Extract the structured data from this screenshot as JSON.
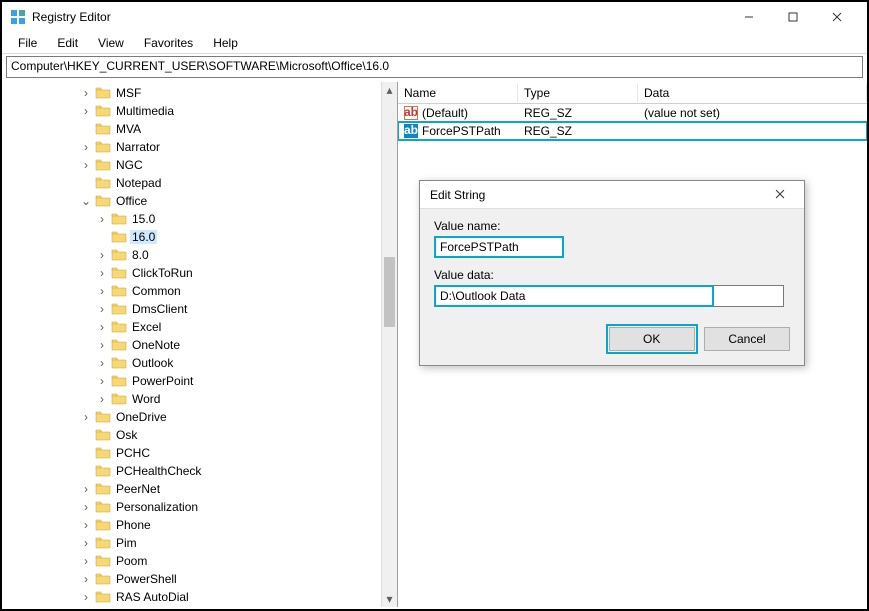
{
  "window": {
    "title": "Registry Editor"
  },
  "menu": {
    "file": "File",
    "edit": "Edit",
    "view": "View",
    "favorites": "Favorites",
    "help": "Help"
  },
  "address": "Computer\\HKEY_CURRENT_USER\\SOFTWARE\\Microsoft\\Office\\16.0",
  "columns": {
    "name": "Name",
    "type": "Type",
    "data": "Data"
  },
  "values": [
    {
      "name": "(Default)",
      "type": "REG_SZ",
      "data": "(value not set)",
      "selected": false
    },
    {
      "name": "ForcePSTPath",
      "type": "REG_SZ",
      "data": "",
      "selected": true
    }
  ],
  "tree": {
    "items": [
      {
        "label": "MSF",
        "depth": 3,
        "expander": ">"
      },
      {
        "label": "Multimedia",
        "depth": 3,
        "expander": ">"
      },
      {
        "label": "MVA",
        "depth": 3,
        "expander": ""
      },
      {
        "label": "Narrator",
        "depth": 3,
        "expander": ">"
      },
      {
        "label": "NGC",
        "depth": 3,
        "expander": ">"
      },
      {
        "label": "Notepad",
        "depth": 3,
        "expander": ""
      },
      {
        "label": "Office",
        "depth": 3,
        "expander": "v"
      },
      {
        "label": "15.0",
        "depth": 4,
        "expander": ">"
      },
      {
        "label": "16.0",
        "depth": 4,
        "expander": "",
        "selected": true
      },
      {
        "label": "8.0",
        "depth": 4,
        "expander": ">"
      },
      {
        "label": "ClickToRun",
        "depth": 4,
        "expander": ">"
      },
      {
        "label": "Common",
        "depth": 4,
        "expander": ">"
      },
      {
        "label": "DmsClient",
        "depth": 4,
        "expander": ">"
      },
      {
        "label": "Excel",
        "depth": 4,
        "expander": ">"
      },
      {
        "label": "OneNote",
        "depth": 4,
        "expander": ">"
      },
      {
        "label": "Outlook",
        "depth": 4,
        "expander": ">"
      },
      {
        "label": "PowerPoint",
        "depth": 4,
        "expander": ">"
      },
      {
        "label": "Word",
        "depth": 4,
        "expander": ">"
      },
      {
        "label": "OneDrive",
        "depth": 3,
        "expander": ">"
      },
      {
        "label": "Osk",
        "depth": 3,
        "expander": ""
      },
      {
        "label": "PCHC",
        "depth": 3,
        "expander": ""
      },
      {
        "label": "PCHealthCheck",
        "depth": 3,
        "expander": ""
      },
      {
        "label": "PeerNet",
        "depth": 3,
        "expander": ">"
      },
      {
        "label": "Personalization",
        "depth": 3,
        "expander": ">"
      },
      {
        "label": "Phone",
        "depth": 3,
        "expander": ">"
      },
      {
        "label": "Pim",
        "depth": 3,
        "expander": ">"
      },
      {
        "label": "Poom",
        "depth": 3,
        "expander": ">"
      },
      {
        "label": "PowerShell",
        "depth": 3,
        "expander": ">"
      },
      {
        "label": "RAS AutoDial",
        "depth": 3,
        "expander": ">"
      }
    ]
  },
  "dialog": {
    "title": "Edit String",
    "value_name_label": "Value name:",
    "value_name": "ForcePSTPath",
    "value_data_label": "Value data:",
    "value_data": "D:\\Outlook Data",
    "ok": "OK",
    "cancel": "Cancel"
  }
}
